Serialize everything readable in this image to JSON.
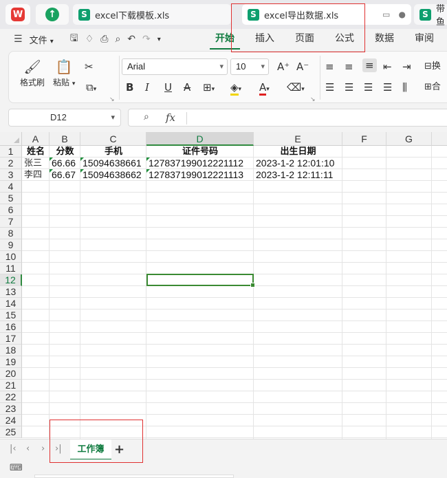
{
  "tabs": {
    "wps_logo": "W",
    "upload_icon": "up-arrow-icon",
    "file1": "excel下载模板.xls",
    "file2": "excel导出数据.xls",
    "file3": "带鱼",
    "sheet_icon_letter": "S"
  },
  "menu": {
    "file": "文件",
    "tabs": [
      "开始",
      "插入",
      "页面",
      "公式",
      "数据",
      "审阅"
    ],
    "active_index": 0
  },
  "ribbon": {
    "format_painter": "格式刷",
    "paste": "粘贴",
    "font_name": "Arial",
    "font_size": "10",
    "bold": "B",
    "italic": "I",
    "underline": "U",
    "strike": "A",
    "wrap": "换",
    "merge": "合"
  },
  "formula_bar": {
    "cell_ref": "D12",
    "fx": "fx",
    "content": ""
  },
  "grid": {
    "columns": [
      "A",
      "B",
      "C",
      "D",
      "E",
      "F",
      "G"
    ],
    "selected_column": "D",
    "rows": [
      "1",
      "2",
      "3",
      "4",
      "5",
      "6",
      "7",
      "8",
      "9",
      "10",
      "11",
      "12",
      "13",
      "14",
      "15",
      "16",
      "17",
      "18",
      "19",
      "20",
      "21",
      "22",
      "23",
      "24",
      "25"
    ],
    "selected_row": "12",
    "header": [
      "姓名",
      "分数",
      "手机",
      "证件号码",
      "出生日期"
    ],
    "data": [
      [
        "张三",
        "66.66",
        "15094638661",
        "127837199012221112",
        "2023-1-2 12:01:10"
      ],
      [
        "李四",
        "66.67",
        "15094638662",
        "127837199012221113",
        "2023-1-2 12:11:11"
      ]
    ]
  },
  "sheetbar": {
    "sheet_name": "工作簿",
    "add": "+"
  },
  "colors": {
    "accent": "#0f7b3f",
    "annotation": "#e03030"
  }
}
